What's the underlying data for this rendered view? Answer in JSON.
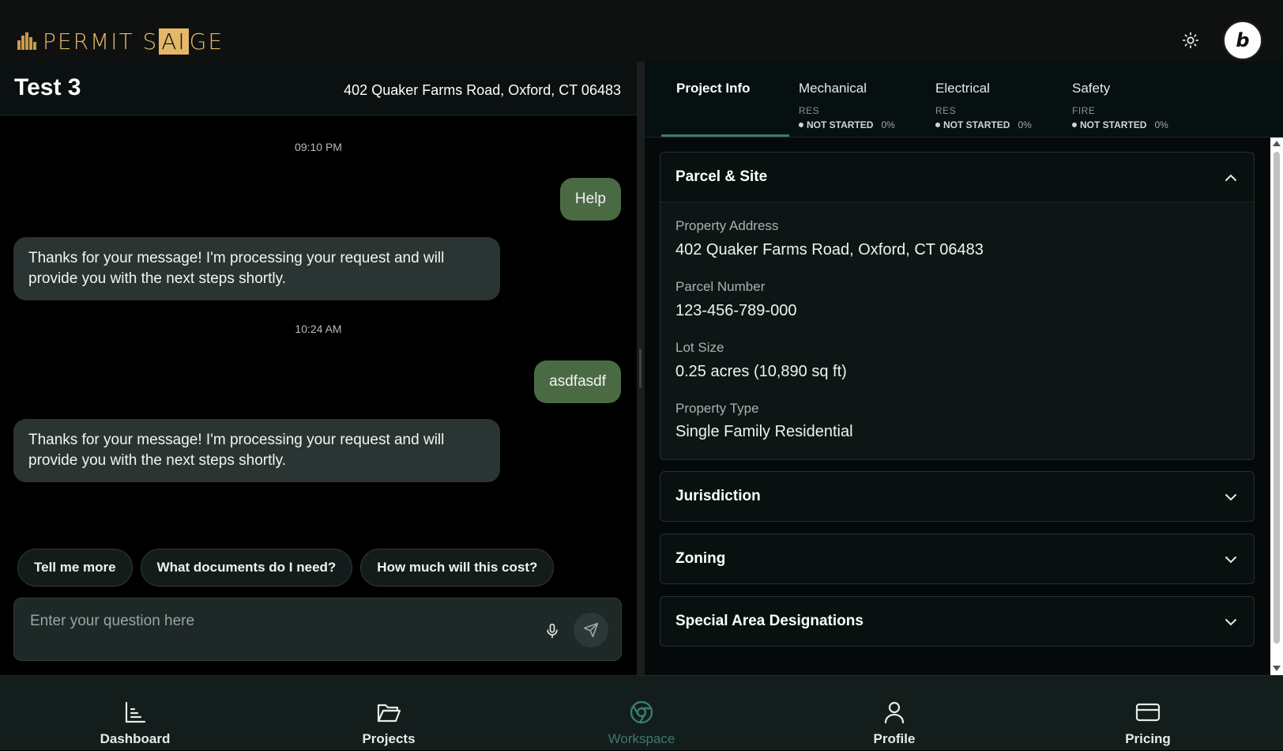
{
  "app": {
    "logo_text_1": "PERMIT S",
    "logo_text_ai": "AI",
    "logo_text_2": "GE",
    "avatar_letter": "b"
  },
  "chat": {
    "project_title": "Test 3",
    "project_address": "402 Quaker Farms Road, Oxford, CT 06483",
    "messages": [
      {
        "type": "timestamp",
        "text": "09:10 PM"
      },
      {
        "type": "user",
        "text": "Help"
      },
      {
        "type": "bot",
        "text": "Thanks for your message! I'm processing your request and will provide you with the next steps shortly."
      },
      {
        "type": "timestamp",
        "text": "10:24 AM"
      },
      {
        "type": "user",
        "text": "asdfasdf"
      },
      {
        "type": "bot",
        "text": "Thanks for your message! I'm processing your request and will provide you with the next steps shortly."
      }
    ],
    "suggestions": [
      "Tell me more",
      "What documents do I need?",
      "How much will this cost?"
    ],
    "input_placeholder": "Enter your question here",
    "input_value": ""
  },
  "tabs": [
    {
      "title": "Project Info",
      "active": true
    },
    {
      "title": "Mechanical",
      "sub": "RES",
      "status": "NOT STARTED",
      "pct": "0%"
    },
    {
      "title": "Electrical",
      "sub": "RES",
      "status": "NOT STARTED",
      "pct": "0%"
    },
    {
      "title": "Safety",
      "sub": "FIRE",
      "status": "NOT STARTED",
      "pct": "0%"
    }
  ],
  "sections": [
    {
      "title": "Parcel & Site",
      "expanded": true,
      "fields": [
        {
          "label": "Property Address",
          "value": "402 Quaker Farms Road, Oxford, CT 06483"
        },
        {
          "label": "Parcel Number",
          "value": "123-456-789-000"
        },
        {
          "label": "Lot Size",
          "value": "0.25 acres (10,890 sq ft)"
        },
        {
          "label": "Property Type",
          "value": "Single Family Residential"
        }
      ]
    },
    {
      "title": "Jurisdiction",
      "expanded": false
    },
    {
      "title": "Zoning",
      "expanded": false
    },
    {
      "title": "Special Area Designations",
      "expanded": false
    }
  ],
  "nav": [
    {
      "label": "Dashboard",
      "icon": "chart-icon"
    },
    {
      "label": "Projects",
      "icon": "folder-icon"
    },
    {
      "label": "Workspace",
      "icon": "workspace-icon",
      "active": true
    },
    {
      "label": "Profile",
      "icon": "user-icon"
    },
    {
      "label": "Pricing",
      "icon": "card-icon"
    }
  ],
  "colors": {
    "accent": "#3c7a6e",
    "user_bubble": "#4a6a44",
    "bot_bubble": "#2a3533",
    "logo_gold": "#e4b868"
  }
}
